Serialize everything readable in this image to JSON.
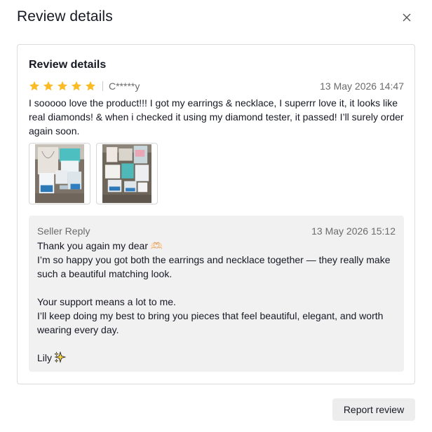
{
  "modal": {
    "title": "Review details",
    "close_icon": "close-icon"
  },
  "review": {
    "card_title": "Review details",
    "rating": 5,
    "rating_max": 5,
    "star_color": "#FBBB24",
    "reviewer": "C*****y",
    "date": "13 May 2026 14:47",
    "text": "I sooooo love the product!!! I got my earrings & necklace, I superrr love it, it looks like real diamonds! & when i checked it using my diamond tester, it passed! I’ll surely order again soon.",
    "photos": [
      "review-photo-1",
      "review-photo-2"
    ]
  },
  "seller_reply": {
    "label": "Seller Reply",
    "date": "13 May 2026 15:12",
    "lines": [
      "Thank you again my dear 🫶🏻",
      "I’m so happy you got both the earrings and necklace together — they really make such a beautiful matching look.",
      "",
      "Your support means a lot to me.",
      "I’ll keep doing my best to bring you pieces that feel beautiful, elegant, and worth wearing every day.",
      "",
      "Lily"
    ],
    "sign_icon": "sparkles-icon"
  },
  "actions": {
    "report_label": "Report review"
  }
}
